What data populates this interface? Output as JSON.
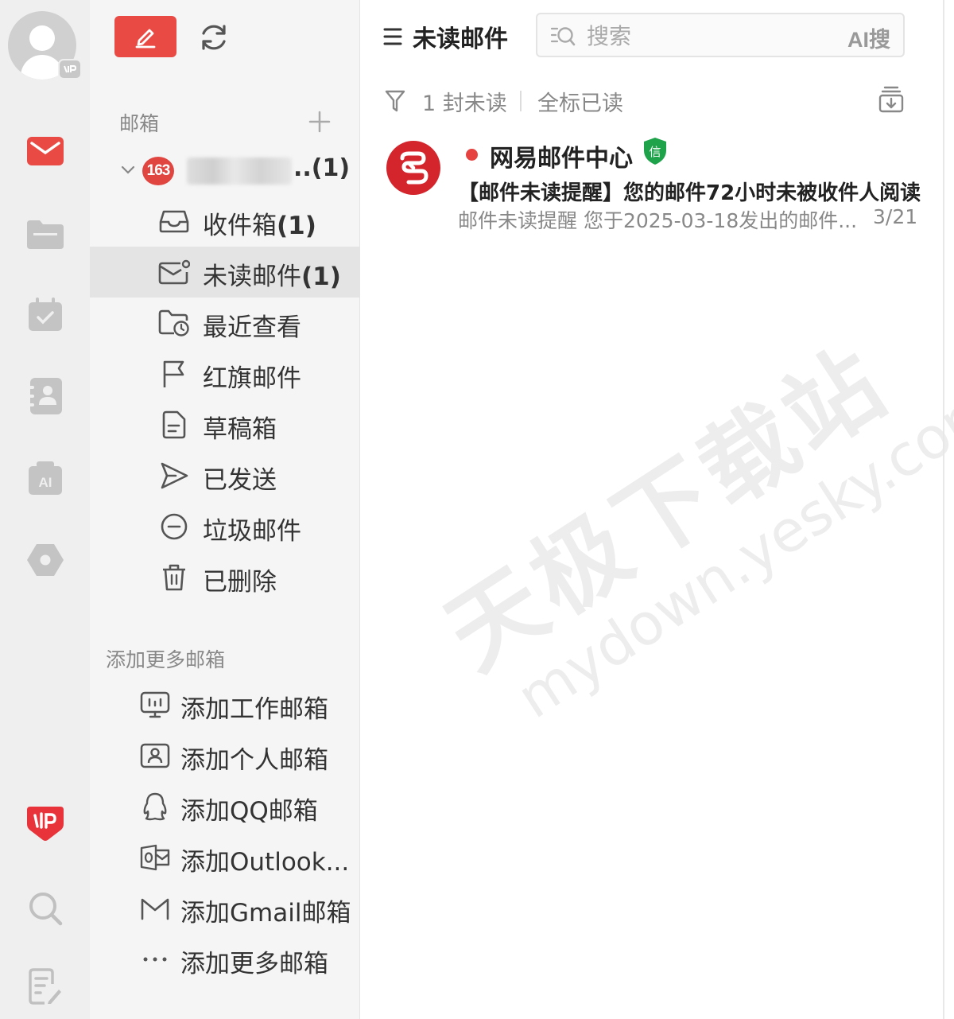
{
  "colors": {
    "accent": "#ea4a44",
    "active_bg": "#e4e4e4",
    "rail_bg": "#efefef",
    "sidebar_bg": "#f5f5f5"
  },
  "rail": {
    "items": [
      {
        "icon": "mail-icon"
      },
      {
        "icon": "folder-icon"
      },
      {
        "icon": "calendar-icon"
      },
      {
        "icon": "contacts-icon"
      },
      {
        "icon": "ai-icon",
        "text": "AI"
      },
      {
        "icon": "settings-hexagon-icon"
      },
      {
        "icon": "dashi-logo-icon"
      },
      {
        "icon": "search-icon"
      },
      {
        "icon": "notes-edit-icon"
      }
    ]
  },
  "sidebar": {
    "section_title": "邮箱",
    "account": {
      "badge": "163",
      "count": "..(1)"
    },
    "folders": [
      {
        "label": "收件箱",
        "count": "(1)",
        "icon": "inbox-icon"
      },
      {
        "label": "未读邮件",
        "count": "(1)",
        "icon": "unread-mail-icon"
      },
      {
        "label": "最近查看",
        "count": "",
        "icon": "recent-folder-icon"
      },
      {
        "label": "红旗邮件",
        "count": "",
        "icon": "flag-icon"
      },
      {
        "label": "草稿箱",
        "count": "",
        "icon": "draft-icon"
      },
      {
        "label": "已发送",
        "count": "",
        "icon": "send-icon"
      },
      {
        "label": "垃圾邮件",
        "count": "",
        "icon": "spam-icon"
      },
      {
        "label": "已删除",
        "count": "",
        "icon": "trash-icon"
      }
    ],
    "more_title": "添加更多邮箱",
    "more_items": [
      {
        "label": "添加工作邮箱",
        "icon": "work-mailbox-icon"
      },
      {
        "label": "添加个人邮箱",
        "icon": "personal-mailbox-icon"
      },
      {
        "label": "添加QQ邮箱",
        "icon": "qq-icon"
      },
      {
        "label": "添加Outlook...",
        "icon": "outlook-icon"
      },
      {
        "label": "添加Gmail邮箱",
        "icon": "gmail-icon"
      },
      {
        "label": "添加更多邮箱",
        "icon": "more-dots-icon"
      }
    ]
  },
  "main": {
    "title": "未读邮件",
    "search_placeholder": "搜索",
    "ai_search": "AI搜",
    "unread_count": "1 封未读",
    "mark_all_read": "全标已读",
    "mails": [
      {
        "sender": "网易邮件中心",
        "verified_badge": "信",
        "subject": "【邮件未读提醒】您的邮件72小时未被收件人阅读",
        "preview": "邮件未读提醒 您于2025-03-18发出的邮件...",
        "date": "3/21"
      }
    ],
    "watermark_1": "天极下载站",
    "watermark_2": "mydown.yesky.com"
  }
}
